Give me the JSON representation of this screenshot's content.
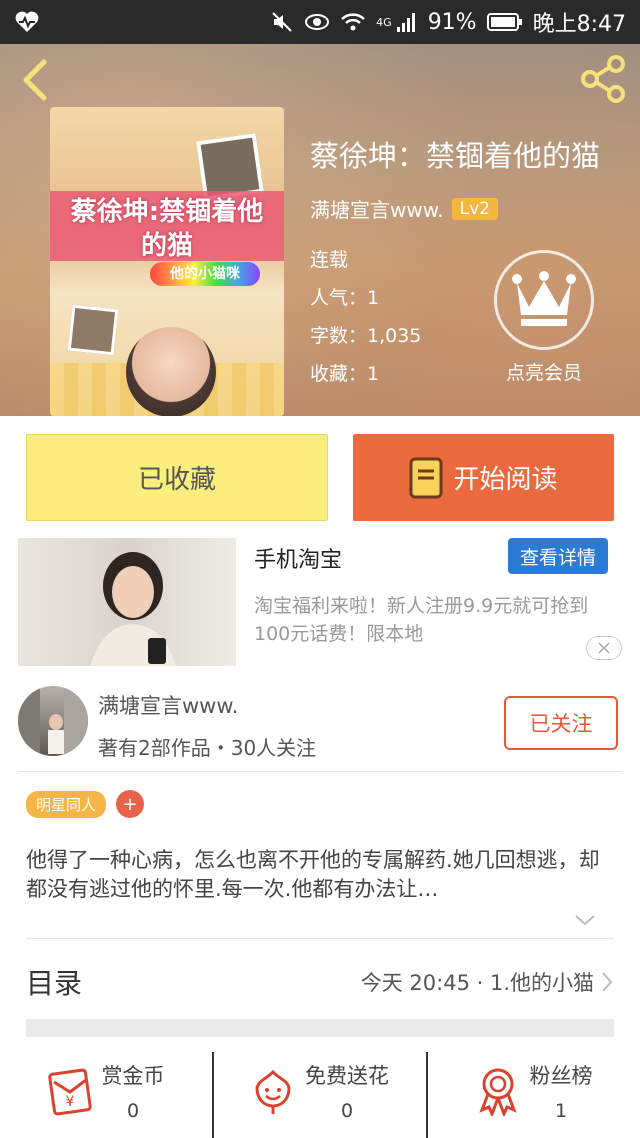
{
  "status_bar": {
    "battery": "91%",
    "network": "4G",
    "time": "晚上8:47"
  },
  "book": {
    "title": "蔡徐坤：禁锢着他的猫",
    "author": "满塘宣言www.",
    "level": "Lv2",
    "status": "连载",
    "popularity": "人气：1",
    "word_count": "字数：1,035",
    "favorites": "收藏：1",
    "cover_text": "蔡徐坤:禁锢着他的猫",
    "cover_badge": "他的小猫咪"
  },
  "vip": {
    "label": "点亮会员"
  },
  "actions": {
    "collected_label": "已收藏",
    "read_label": "开始阅读"
  },
  "ad": {
    "title": "手机淘宝",
    "detail_label": "查看详情",
    "description": "淘宝福利来啦！新人注册9.9元就可抢到100元话费！限本地"
  },
  "author_card": {
    "name": "满塘宣言www.",
    "stats": "著有2部作品・30人关注",
    "follow_label": "已关注"
  },
  "tags": {
    "items": [
      "明星同人"
    ],
    "add_label": "+"
  },
  "synopsis": "他得了一种心病，怎么也离不开他的专属解药.她几回想逃，却都没有逃过他的怀里.每一次.他都有办法让…",
  "toc": {
    "label": "目录",
    "latest": "今天 20:45 · 1.他的小猫"
  },
  "bottom": {
    "reward": {
      "label": "赏金币",
      "count": "0"
    },
    "flowers": {
      "label": "免费送花",
      "count": "0"
    },
    "fans": {
      "label": "粉丝榜",
      "count": "1"
    }
  },
  "colors": {
    "accent_orange": "#ea6a3e",
    "collected_yellow": "#fcee7c",
    "ad_blue": "#2b7bd4",
    "tag_yellow": "#f5b547",
    "red_icon": "#d9432e"
  },
  "icons": [
    "heart-monitor-icon",
    "mute-icon",
    "eye-icon",
    "wifi-icon",
    "signal-icon",
    "battery-icon",
    "back-icon",
    "share-icon",
    "crown-icon",
    "book-icon",
    "close-icon",
    "chevron-down-icon",
    "chevron-right-icon",
    "red-envelope-icon",
    "flower-icon",
    "medal-icon"
  ]
}
